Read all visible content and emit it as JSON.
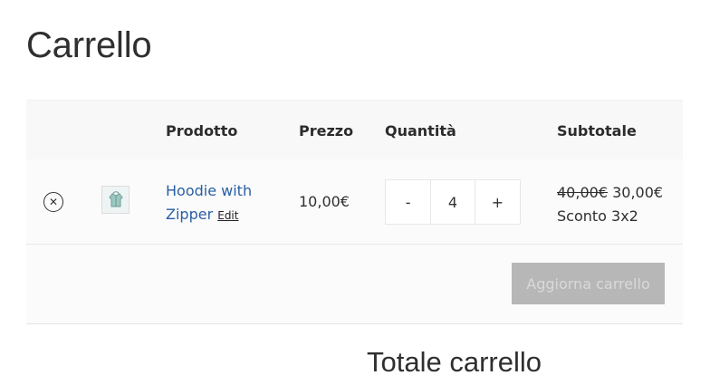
{
  "page": {
    "title": "Carrello"
  },
  "table": {
    "headers": {
      "product": "Prodotto",
      "price": "Prezzo",
      "quantity": "Quantità",
      "subtotal": "Subtotale"
    },
    "row": {
      "remove_icon": "close-icon",
      "thumbnail_icon": "hoodie-icon",
      "product_name_line1": "Hoodie with",
      "product_name_line2": "Zipper",
      "edit_label": "Edit",
      "price": "10,00€",
      "quantity": {
        "minus": "-",
        "value": "4",
        "plus": "+"
      },
      "subtotal": {
        "old": "40,00€",
        "new": "30,00€",
        "discount": "Sconto 3x2"
      }
    },
    "actions": {
      "update_label": "Aggiorna carrello"
    }
  },
  "totals": {
    "title": "Totale carrello"
  },
  "colors": {
    "link": "#2a5fa4",
    "disabled_button_bg": "#b7b7b7",
    "disabled_button_text": "#d9d9d9"
  }
}
